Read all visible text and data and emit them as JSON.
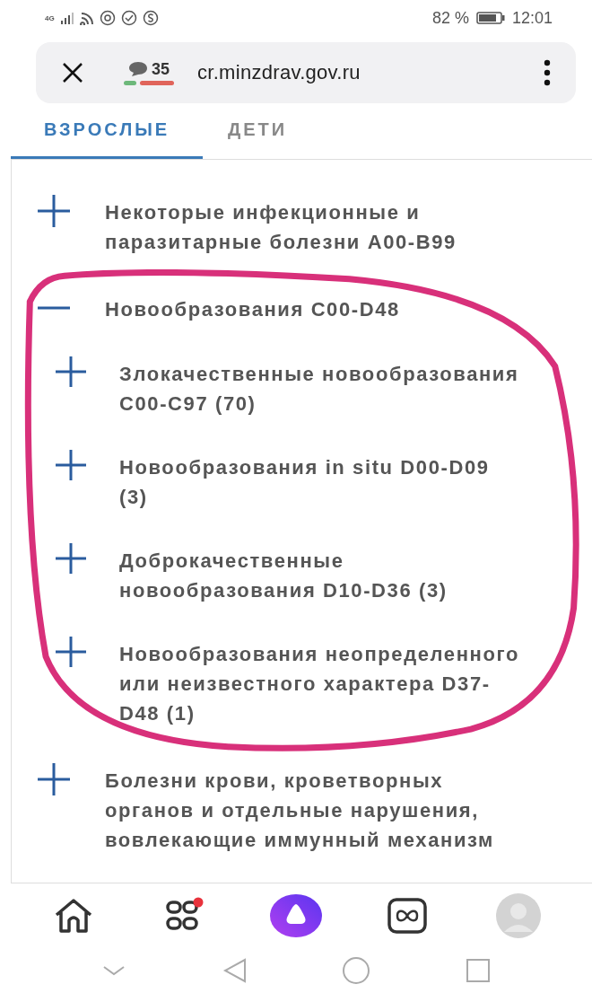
{
  "status_bar": {
    "network": "4G",
    "battery": "82 %",
    "time": "12:01"
  },
  "browser_bar": {
    "comments": "35",
    "url": "cr.minzdrav.gov.ru"
  },
  "tabs": [
    {
      "label": "ВЗРОСЛЫЕ",
      "selected": true
    },
    {
      "label": "ДЕТИ",
      "selected": false
    }
  ],
  "tree": [
    {
      "label": "Некоторые инфекционные и паразитарные болезни A00-B99",
      "expanded": false,
      "circled": false
    },
    {
      "label": "Новообразования C00-D48",
      "expanded": true,
      "circled": true,
      "children": [
        {
          "label": "Злокачественные новообразования C00-C97 (70)",
          "expanded": false
        },
        {
          "label": "Новообразования in situ D00-D09 (3)",
          "expanded": false
        },
        {
          "label": "Доброкачественные новообразования D10-D36 (3)",
          "expanded": false
        },
        {
          "label": "Новообразования неопределенного или неизвестного характера D37-D48 (1)",
          "expanded": false
        }
      ]
    },
    {
      "label": "Болезни крови, кроветворных органов и отдельные нарушения, вовлекающие иммунный механизм",
      "expanded": false,
      "circled": false
    }
  ],
  "bottom_nav": [
    {
      "kind": "home"
    },
    {
      "kind": "apps",
      "badge": true
    },
    {
      "kind": "assistant"
    },
    {
      "kind": "loop"
    },
    {
      "kind": "avatar"
    }
  ]
}
